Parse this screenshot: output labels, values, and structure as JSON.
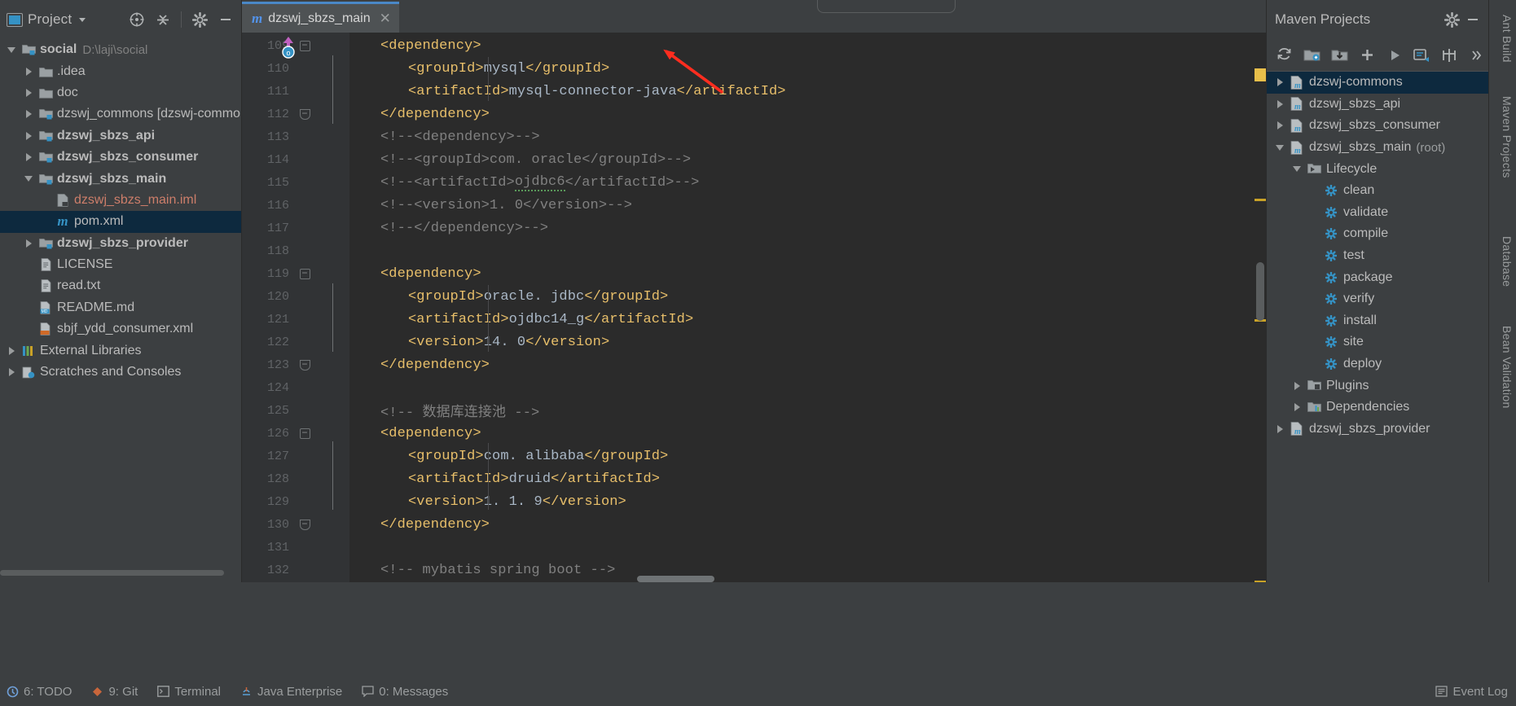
{
  "app": {
    "theme_bg": "#3c3f41",
    "editor_bg": "#2b2b2b",
    "accent": "#4a88c7",
    "selection_bg": "#0d293e"
  },
  "project_panel": {
    "title": "Project",
    "icons": {
      "window": "project-window-icon",
      "dropdown": "chevron-down-icon",
      "locate": "locate-icon",
      "collapse": "collapse-all-icon",
      "settings": "gear-icon",
      "hide": "hide-icon"
    },
    "tree": [
      {
        "indent": 0,
        "twisty": "down",
        "icon": "module-folder-icon",
        "label": "social",
        "bold": true,
        "suffix": "D:\\laji\\social",
        "selected": false
      },
      {
        "indent": 1,
        "twisty": "right",
        "icon": "folder-icon",
        "label": ".idea",
        "bold": false,
        "suffix": "",
        "selected": false
      },
      {
        "indent": 1,
        "twisty": "right",
        "icon": "folder-icon",
        "label": "doc",
        "bold": false,
        "suffix": "",
        "selected": false
      },
      {
        "indent": 1,
        "twisty": "right",
        "icon": "module-folder-icon",
        "label": "dzswj_commons [dzswj-commo",
        "bold": false,
        "suffix": "",
        "selected": false
      },
      {
        "indent": 1,
        "twisty": "right",
        "icon": "module-folder-icon",
        "label": "dzswj_sbzs_api",
        "bold": true,
        "suffix": "",
        "selected": false
      },
      {
        "indent": 1,
        "twisty": "right",
        "icon": "module-folder-icon",
        "label": "dzswj_sbzs_consumer",
        "bold": true,
        "suffix": "",
        "selected": false
      },
      {
        "indent": 1,
        "twisty": "down",
        "icon": "module-folder-icon",
        "label": "dzswj_sbzs_main",
        "bold": true,
        "suffix": "",
        "selected": false
      },
      {
        "indent": 2,
        "twisty": "none",
        "icon": "iml-file-icon",
        "label": "dzswj_sbzs_main.iml",
        "bold": false,
        "suffix": "",
        "selected": false,
        "color": "iml"
      },
      {
        "indent": 2,
        "twisty": "none",
        "icon": "maven-file-icon",
        "label": "pom.xml",
        "bold": false,
        "suffix": "",
        "selected": true
      },
      {
        "indent": 1,
        "twisty": "right",
        "icon": "module-folder-icon",
        "label": "dzswj_sbzs_provider",
        "bold": true,
        "suffix": "",
        "selected": false
      },
      {
        "indent": 1,
        "twisty": "none",
        "icon": "text-file-icon",
        "label": "LICENSE",
        "bold": false,
        "suffix": "",
        "selected": false
      },
      {
        "indent": 1,
        "twisty": "none",
        "icon": "text-file-icon",
        "label": "read.txt",
        "bold": false,
        "suffix": "",
        "selected": false
      },
      {
        "indent": 1,
        "twisty": "none",
        "icon": "markdown-file-icon",
        "label": "README.md",
        "bold": false,
        "suffix": "",
        "selected": false
      },
      {
        "indent": 1,
        "twisty": "none",
        "icon": "xml-file-icon",
        "label": "sbjf_ydd_consumer.xml",
        "bold": false,
        "suffix": "",
        "selected": false
      },
      {
        "indent": 0,
        "twisty": "right",
        "icon": "libraries-icon",
        "label": "External Libraries",
        "bold": false,
        "suffix": "",
        "selected": false
      },
      {
        "indent": 0,
        "twisty": "right",
        "icon": "scratches-icon",
        "label": "Scratches and Consoles",
        "bold": false,
        "suffix": "",
        "selected": false
      }
    ]
  },
  "editor": {
    "tab": {
      "label": "dzswj_sbzs_main",
      "icon": "maven-file-icon",
      "close_icon": "close-icon"
    },
    "first_line": 109,
    "lines": [
      {
        "n": 109,
        "indent": 0,
        "fold": "start",
        "segments": [
          {
            "t": "tag",
            "s": "<dependency>"
          }
        ]
      },
      {
        "n": 110,
        "indent": 1,
        "fold": "",
        "segments": [
          {
            "t": "tag",
            "s": "<groupId>"
          },
          {
            "t": "txt",
            "s": "mysql"
          },
          {
            "t": "tag",
            "s": "</groupId>"
          }
        ]
      },
      {
        "n": 111,
        "indent": 1,
        "fold": "",
        "segments": [
          {
            "t": "tag",
            "s": "<artifactId>"
          },
          {
            "t": "txt",
            "s": "mysql-connector-java"
          },
          {
            "t": "tag",
            "s": "</artifactId>"
          }
        ]
      },
      {
        "n": 112,
        "indent": 0,
        "fold": "end",
        "segments": [
          {
            "t": "tag",
            "s": "</dependency>"
          }
        ]
      },
      {
        "n": 113,
        "indent": 0,
        "fold": "",
        "segments": [
          {
            "t": "cmt",
            "s": "<!--<dependency>-->"
          }
        ]
      },
      {
        "n": 114,
        "indent": 0,
        "fold": "",
        "segments": [
          {
            "t": "cmt",
            "s": "<!--<groupId>com. oracle</groupId>-->"
          }
        ]
      },
      {
        "n": 115,
        "indent": 0,
        "fold": "",
        "segments": [
          {
            "t": "cmt",
            "s": "<!--<artifactId>"
          },
          {
            "t": "cmt-sq",
            "s": "ojdbc6"
          },
          {
            "t": "cmt",
            "s": "</artifactId>-->"
          }
        ]
      },
      {
        "n": 116,
        "indent": 0,
        "fold": "",
        "segments": [
          {
            "t": "cmt",
            "s": "<!--<version>1. 0</version>-->"
          }
        ]
      },
      {
        "n": 117,
        "indent": 0,
        "fold": "",
        "segments": [
          {
            "t": "cmt",
            "s": "<!--</dependency>-->"
          }
        ]
      },
      {
        "n": 118,
        "indent": 0,
        "fold": "",
        "segments": []
      },
      {
        "n": 119,
        "indent": 0,
        "fold": "start",
        "segments": [
          {
            "t": "tag",
            "s": "<dependency>"
          }
        ]
      },
      {
        "n": 120,
        "indent": 1,
        "fold": "",
        "segments": [
          {
            "t": "tag",
            "s": "<groupId>"
          },
          {
            "t": "txt",
            "s": "oracle. jdbc"
          },
          {
            "t": "tag",
            "s": "</groupId>"
          }
        ]
      },
      {
        "n": 121,
        "indent": 1,
        "fold": "",
        "segments": [
          {
            "t": "tag",
            "s": "<artifactId>"
          },
          {
            "t": "txt",
            "s": "ojdbc14_g"
          },
          {
            "t": "tag",
            "s": "</artifactId>"
          }
        ]
      },
      {
        "n": 122,
        "indent": 1,
        "fold": "",
        "segments": [
          {
            "t": "tag",
            "s": "<version>"
          },
          {
            "t": "txt",
            "s": "14. 0"
          },
          {
            "t": "tag",
            "s": "</version>"
          }
        ]
      },
      {
        "n": 123,
        "indent": 0,
        "fold": "end",
        "segments": [
          {
            "t": "tag",
            "s": "</dependency>"
          }
        ]
      },
      {
        "n": 124,
        "indent": 0,
        "fold": "",
        "segments": []
      },
      {
        "n": 125,
        "indent": 0,
        "fold": "",
        "segments": [
          {
            "t": "cmt",
            "s": "<!-- 数据库连接池 -->"
          }
        ]
      },
      {
        "n": 126,
        "indent": 0,
        "fold": "start",
        "segments": [
          {
            "t": "tag",
            "s": "<dependency>"
          }
        ]
      },
      {
        "n": 127,
        "indent": 1,
        "fold": "",
        "segments": [
          {
            "t": "tag",
            "s": "<groupId>"
          },
          {
            "t": "txt",
            "s": "com. alibaba"
          },
          {
            "t": "tag",
            "s": "</groupId>"
          }
        ]
      },
      {
        "n": 128,
        "indent": 1,
        "fold": "",
        "segments": [
          {
            "t": "tag",
            "s": "<artifactId>"
          },
          {
            "t": "txt",
            "s": "druid"
          },
          {
            "t": "tag",
            "s": "</artifactId>"
          }
        ]
      },
      {
        "n": 129,
        "indent": 1,
        "fold": "",
        "segments": [
          {
            "t": "tag",
            "s": "<version>"
          },
          {
            "t": "txt",
            "s": "1. 1. 9"
          },
          {
            "t": "tag",
            "s": "</version>"
          }
        ]
      },
      {
        "n": 130,
        "indent": 0,
        "fold": "end",
        "segments": [
          {
            "t": "tag",
            "s": "</dependency>"
          }
        ]
      },
      {
        "n": 131,
        "indent": 0,
        "fold": "",
        "segments": []
      },
      {
        "n": 132,
        "indent": 0,
        "fold": "",
        "segments": [
          {
            "t": "cmt",
            "s": "<!-- mybatis spring boot -->"
          }
        ]
      }
    ],
    "annotation": {
      "type": "red-arrow",
      "points_to_line": 122,
      "color": "#ff2d1f"
    }
  },
  "maven_panel": {
    "title": "Maven Projects",
    "header_icons": {
      "settings": "gear-icon",
      "hide": "hide-icon"
    },
    "toolbar_icons": [
      "reimport-icon",
      "generate-sources-icon",
      "download-sources-icon",
      "add-maven-project-icon",
      "run-icon",
      "execute-goal-icon",
      "toggle-offline-icon",
      "more-icon"
    ],
    "tree": [
      {
        "indent": 0,
        "twisty": "right",
        "icon": "maven-project-icon",
        "label": "dzswj-commons",
        "suffix": "",
        "selected": true
      },
      {
        "indent": 0,
        "twisty": "right",
        "icon": "maven-project-icon",
        "label": "dzswj_sbzs_api",
        "suffix": "",
        "selected": false
      },
      {
        "indent": 0,
        "twisty": "right",
        "icon": "maven-project-icon",
        "label": "dzswj_sbzs_consumer",
        "suffix": "",
        "selected": false
      },
      {
        "indent": 0,
        "twisty": "down",
        "icon": "maven-project-icon",
        "label": "dzswj_sbzs_main",
        "suffix": "(root)",
        "selected": false
      },
      {
        "indent": 1,
        "twisty": "down",
        "icon": "lifecycle-icon",
        "label": "Lifecycle",
        "suffix": "",
        "selected": false
      },
      {
        "indent": 2,
        "twisty": "none",
        "icon": "maven-goal-icon",
        "label": "clean",
        "suffix": "",
        "selected": false
      },
      {
        "indent": 2,
        "twisty": "none",
        "icon": "maven-goal-icon",
        "label": "validate",
        "suffix": "",
        "selected": false
      },
      {
        "indent": 2,
        "twisty": "none",
        "icon": "maven-goal-icon",
        "label": "compile",
        "suffix": "",
        "selected": false
      },
      {
        "indent": 2,
        "twisty": "none",
        "icon": "maven-goal-icon",
        "label": "test",
        "suffix": "",
        "selected": false
      },
      {
        "indent": 2,
        "twisty": "none",
        "icon": "maven-goal-icon",
        "label": "package",
        "suffix": "",
        "selected": false
      },
      {
        "indent": 2,
        "twisty": "none",
        "icon": "maven-goal-icon",
        "label": "verify",
        "suffix": "",
        "selected": false
      },
      {
        "indent": 2,
        "twisty": "none",
        "icon": "maven-goal-icon",
        "label": "install",
        "suffix": "",
        "selected": false
      },
      {
        "indent": 2,
        "twisty": "none",
        "icon": "maven-goal-icon",
        "label": "site",
        "suffix": "",
        "selected": false
      },
      {
        "indent": 2,
        "twisty": "none",
        "icon": "maven-goal-icon",
        "label": "deploy",
        "suffix": "",
        "selected": false
      },
      {
        "indent": 1,
        "twisty": "right",
        "icon": "plugins-icon",
        "label": "Plugins",
        "suffix": "",
        "selected": false
      },
      {
        "indent": 1,
        "twisty": "right",
        "icon": "dependencies-icon",
        "label": "Dependencies",
        "suffix": "",
        "selected": false
      },
      {
        "indent": 0,
        "twisty": "right",
        "icon": "maven-project-icon",
        "label": "dzswj_sbzs_provider",
        "suffix": "",
        "selected": false
      }
    ]
  },
  "right_strip": {
    "tabs": [
      {
        "label": "Ant Build",
        "icon": "ant-icon"
      },
      {
        "label": "Maven Projects",
        "icon": "maven-icon"
      },
      {
        "label": "Database",
        "icon": "database-icon"
      },
      {
        "label": "Bean Validation",
        "icon": "bean-icon"
      }
    ]
  },
  "status_bar": {
    "left_items": [
      {
        "label": "6: TODO",
        "icon": "todo-icon"
      },
      {
        "label": "9: Git",
        "icon": "git-icon"
      },
      {
        "label": "Terminal",
        "icon": "terminal-icon"
      },
      {
        "label": "Java Enterprise",
        "icon": "java-ee-icon"
      },
      {
        "label": "0: Messages",
        "icon": "messages-icon"
      }
    ],
    "right_items": [
      {
        "label": "Event Log",
        "icon": "event-log-icon"
      }
    ]
  }
}
